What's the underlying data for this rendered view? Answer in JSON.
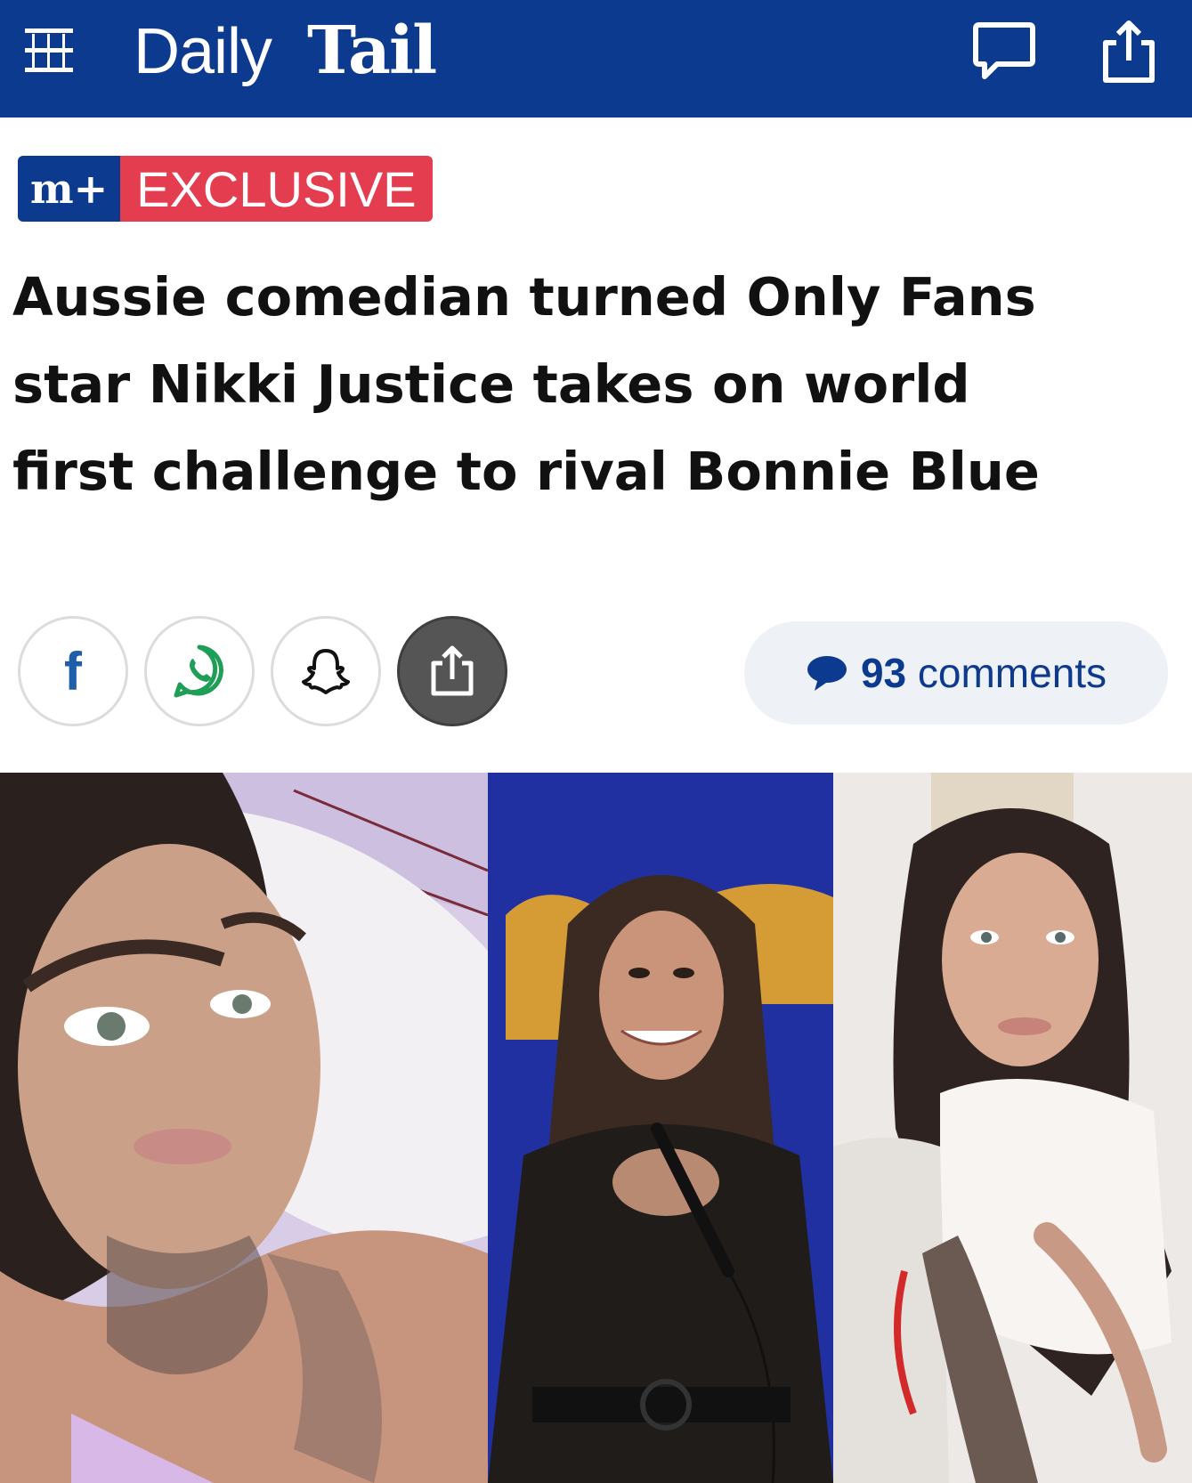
{
  "header": {
    "brand_daily": "Daily",
    "brand_tail": "Tail",
    "bg_color": "#0c3a8f"
  },
  "badge": {
    "mplus": "m+",
    "exclusive": "EXCLUSIVE",
    "blue": "#0c3a8f",
    "red": "#e43d4f"
  },
  "article": {
    "headline": "Aussie comedian turned Only Fans\nstar Nikki Justice  takes on world\nfirst challenge to rival Bonnie Blue"
  },
  "share": {
    "facebook_glyph": "f",
    "buttons": [
      "facebook-icon",
      "whatsapp-icon",
      "snapchat-icon",
      "share-icon"
    ]
  },
  "comments": {
    "count": "93",
    "label": "comments"
  },
  "photos": {
    "items": [
      "photo-selfie-bed",
      "photo-comedy-stage",
      "photo-selfie-white-top"
    ]
  }
}
